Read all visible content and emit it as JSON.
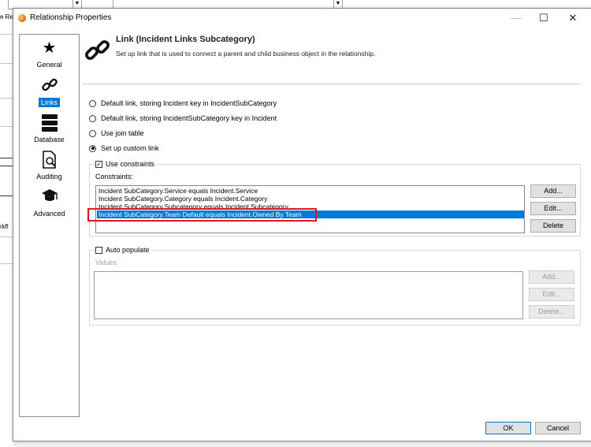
{
  "background": {
    "left_text_top": "e Re",
    "left_text_bottom": "rkfl"
  },
  "dialog": {
    "title": "Relationship Properties",
    "minimize": "—",
    "maximize": "☐",
    "close": "✕"
  },
  "nav": {
    "items": [
      {
        "label": "General",
        "icon": "star-icon",
        "glyph": "★",
        "selected": false
      },
      {
        "label": "Links",
        "icon": "link-icon",
        "glyph": "🔗",
        "selected": true
      },
      {
        "label": "Database",
        "icon": "database-icon",
        "glyph": "≡",
        "selected": false
      },
      {
        "label": "Auditing",
        "icon": "audit-icon",
        "glyph": "🔍",
        "selected": false
      },
      {
        "label": "Advanced",
        "icon": "graduation-cap-icon",
        "glyph": "🎓",
        "selected": false
      }
    ]
  },
  "header": {
    "title": "Link  (Incident Links Subcategory)",
    "subtitle": "Set up link that is used to connect a parent and child business object in the relationship."
  },
  "options": {
    "radio1": "Default link, storing Incident key in IncidentSubCategory",
    "radio2": "Default link, storing IncidentSubCategory key in Incident",
    "radio3": "Use join table",
    "radio4": "Set up custom link",
    "selected": "radio4"
  },
  "constraints": {
    "use_label": "Use constraints",
    "use_checked": true,
    "label": "Constraints:",
    "rows": [
      "Incident SubCategory.Service equals Incident.Service",
      "Incident SubCategory.Category equals Incident.Category",
      "Incident SubCategory.Subcategory equals Incident.Subcategory",
      "Incident SubCategory.Team Default equals Incident.Owned By Team"
    ],
    "selected_index": 3,
    "add": "Add...",
    "edit": "Edit...",
    "delete": "Delete"
  },
  "auto": {
    "label": "Auto populate",
    "checked": false,
    "values_label": "Values:",
    "add": "Add...",
    "edit": "Edit...",
    "delete": "Delete..."
  },
  "footer": {
    "ok": "OK",
    "cancel": "Cancel"
  }
}
